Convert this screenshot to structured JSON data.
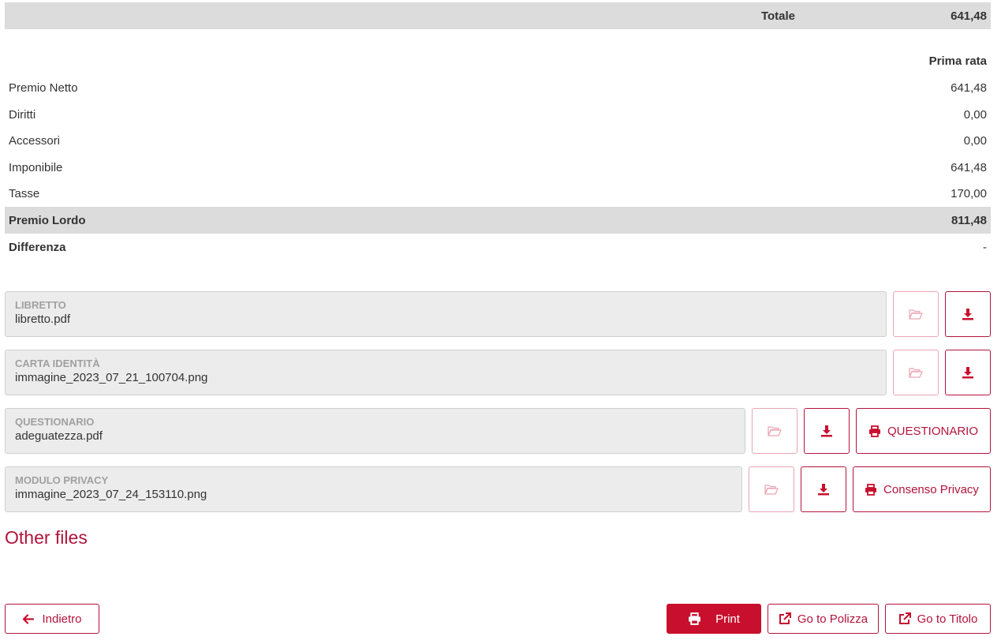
{
  "summary": {
    "totale_label": "Totale",
    "totale_value": "641,48",
    "column_header": "Prima rata",
    "rows": [
      {
        "label": "Premio Netto",
        "value": "641,48"
      },
      {
        "label": "Diritti",
        "value": "0,00"
      },
      {
        "label": "Accessori",
        "value": "0,00"
      },
      {
        "label": "Imponibile",
        "value": "641,48"
      },
      {
        "label": "Tasse",
        "value": "170,00"
      }
    ],
    "premio_lordo_label": "Premio Lordo",
    "premio_lordo_value": "811,48",
    "differenza_label": "Differenza",
    "differenza_value": "-"
  },
  "files": [
    {
      "label": "LIBRETTO",
      "filename": "libretto.pdf"
    },
    {
      "label": "CARTA IDENTITÀ",
      "filename": "immagine_2023_07_21_100704.png"
    },
    {
      "label": "QUESTIONARIO",
      "filename": "adeguatezza.pdf",
      "action_label": "QUESTIONARIO"
    },
    {
      "label": "MODULO PRIVACY",
      "filename": "immagine_2023_07_24_153110.png",
      "action_label": "Consenso Privacy"
    }
  ],
  "other_files_title": "Other files",
  "footer": {
    "back_label": "Indietro",
    "print_label": "Print",
    "polizza_label": "Go to Polizza",
    "titolo_label": "Go to Titolo"
  },
  "colors": {
    "accent": "#c8102e",
    "border": "#b3143c",
    "row_grey": "#dcdcdc",
    "field_bg": "#ececec"
  },
  "icons": [
    "folder-open-icon",
    "download-icon",
    "printer-icon",
    "arrow-left-icon",
    "external-link-icon"
  ]
}
